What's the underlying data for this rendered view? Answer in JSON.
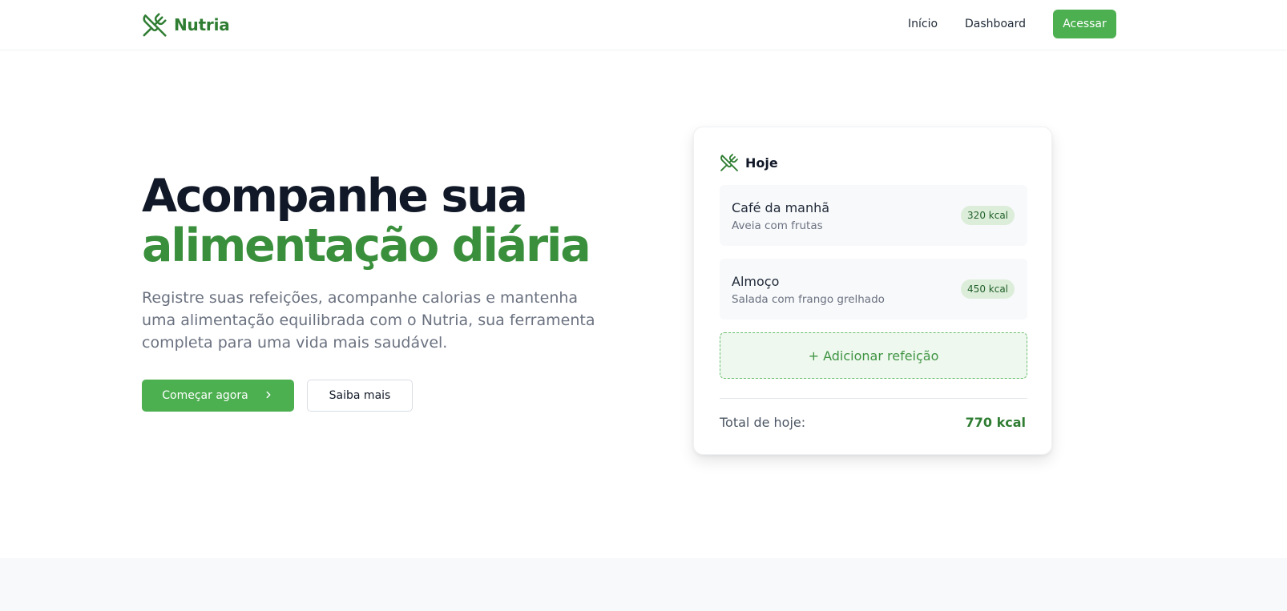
{
  "header": {
    "brand": "Nutria",
    "nav": {
      "home": "Início",
      "dashboard": "Dashboard",
      "login": "Acessar"
    }
  },
  "hero": {
    "title_line1": "Acompanhe sua",
    "title_line2": "alimentação diária",
    "description": "Registre suas refeições, acompanhe calorias e mantenha uma alimentação equilibrada com o Nutria, sua ferramenta completa para uma vida mais saudável.",
    "cta_primary": "Começar agora",
    "cta_secondary": "Saiba mais"
  },
  "card": {
    "title": "Hoje",
    "meals": [
      {
        "name": "Café da manhã",
        "description": "Aveia com frutas",
        "calories": "320 kcal"
      },
      {
        "name": "Almoço",
        "description": "Salada com frango grelhado",
        "calories": "450 kcal"
      }
    ],
    "add_meal": "+ Adicionar refeição",
    "total_label": "Total de hoje:",
    "total_value": "770 kcal"
  },
  "icons": {
    "logo": "utensils-crossed-icon",
    "card": "utensils-crossed-icon",
    "cta_primary": "chevron-right-icon"
  },
  "colors": {
    "brand_green": "#4caf50",
    "brand_dark_green": "#2f7d32",
    "heading_dark": "#111827",
    "muted_text": "#6b7280"
  }
}
